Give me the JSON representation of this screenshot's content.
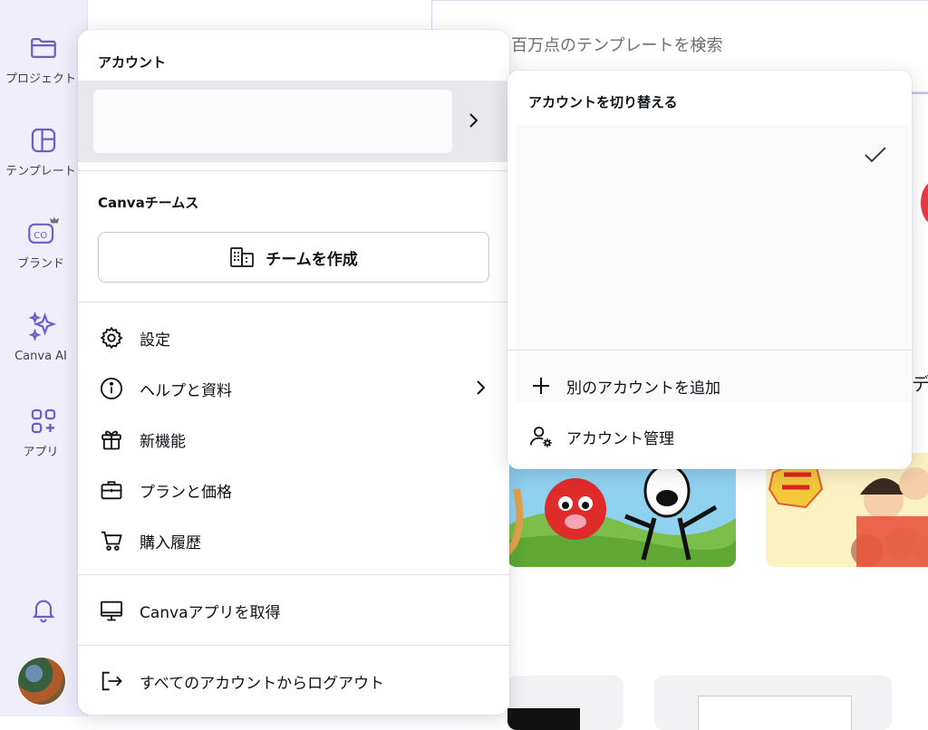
{
  "sidebar": {
    "items": [
      {
        "label": "プロジェクト",
        "icon": "folder-icon"
      },
      {
        "label": "テンプレート",
        "icon": "template-icon"
      },
      {
        "label": "ブランド",
        "icon": "brand-kit-icon"
      },
      {
        "label": "Canva AI",
        "icon": "sparkles-icon"
      },
      {
        "label": "アプリ",
        "icon": "apps-icon"
      }
    ],
    "bell_icon": "bell-icon",
    "avatar": "user-avatar"
  },
  "search": {
    "placeholder": "百万点のテンプレートを検索"
  },
  "background": {
    "side_text": "デ"
  },
  "account_menu": {
    "account_section_title": "アカウント",
    "teams_section_title": "Canvaチームス",
    "create_team_label": "チームを作成",
    "items": [
      {
        "label": "設定",
        "icon": "gear-icon"
      },
      {
        "label": "ヘルプと資料",
        "icon": "info-icon"
      },
      {
        "label": "新機能",
        "icon": "gift-icon"
      },
      {
        "label": "プランと価格",
        "icon": "briefcase-icon"
      },
      {
        "label": "購入履歴",
        "icon": "cart-icon"
      }
    ],
    "get_app_label": "Canvaアプリを取得",
    "logout_label": "すべてのアカウントからログアウト"
  },
  "switch_account": {
    "title": "アカウントを切り替える",
    "add_account_label": "別のアカウントを追加",
    "manage_account_label": "アカウント管理"
  },
  "colors": {
    "accent": "#7d2ae8",
    "rail_bg": "#f1eefb",
    "icon": "#6b5fc7"
  }
}
